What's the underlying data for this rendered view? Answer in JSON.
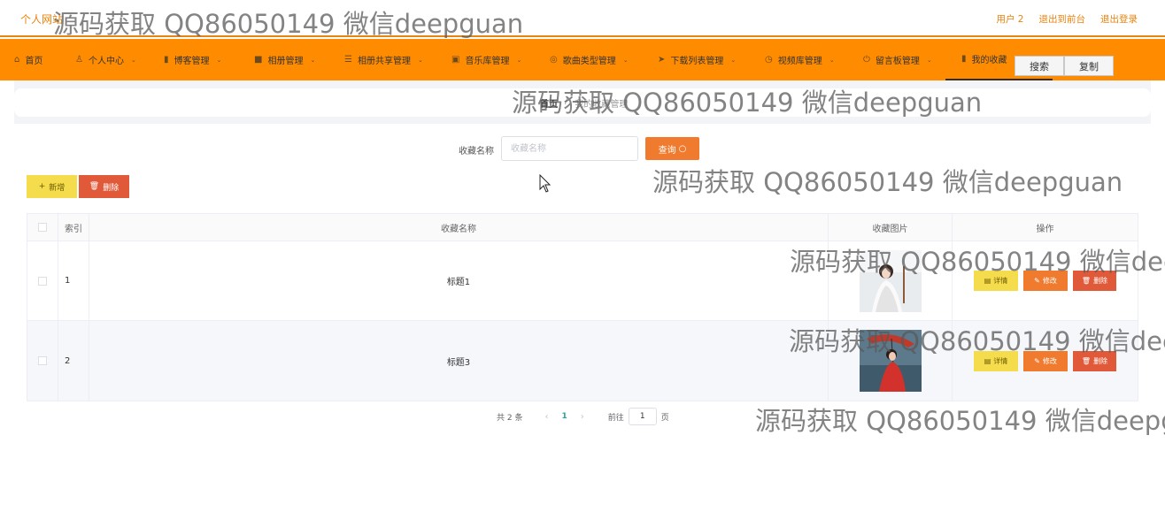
{
  "header": {
    "site_title": "个人网站",
    "links": [
      "用户 2",
      "退出到前台",
      "退出登录"
    ]
  },
  "nav": {
    "items": [
      {
        "label": "首页",
        "icon": "home-icon"
      },
      {
        "label": "个人中心",
        "icon": "user-icon"
      },
      {
        "label": "博客管理",
        "icon": "chart-icon"
      },
      {
        "label": "相册管理",
        "icon": "camera-icon"
      },
      {
        "label": "相册共享管理",
        "icon": "list-icon"
      },
      {
        "label": "音乐库管理",
        "icon": "music-icon"
      },
      {
        "label": "歌曲类型管理",
        "icon": "tag-icon"
      },
      {
        "label": "下载列表管理",
        "icon": "send-icon"
      },
      {
        "label": "视频库管理",
        "icon": "video-icon"
      },
      {
        "label": "留言板管理",
        "icon": "power-icon"
      },
      {
        "label": "我的收藏",
        "icon": "bookmark-icon"
      }
    ],
    "search_button": "搜索",
    "copy_button": "复制"
  },
  "breadcrumb": {
    "home": "首页",
    "current": "我的收藏管理"
  },
  "search": {
    "label": "收藏名称",
    "placeholder": "收藏名称",
    "value": "",
    "query_button": "查询"
  },
  "actions": {
    "add": "新增",
    "delete": "删除"
  },
  "table": {
    "headers": {
      "index": "索引",
      "name": "收藏名称",
      "image": "收藏图片",
      "ops": "操作"
    },
    "rows": [
      {
        "index": "1",
        "name": "标题1",
        "image": "portrait-white-dress"
      },
      {
        "index": "2",
        "name": "标题3",
        "image": "portrait-red-dress"
      }
    ],
    "op_labels": {
      "detail": "详情",
      "edit": "修改",
      "remove": "删除"
    }
  },
  "pagination": {
    "total": "共 2 条",
    "current": "1",
    "goto_prefix": "前往",
    "goto_value": "1",
    "goto_suffix": "页"
  },
  "watermark": "源码获取 QQ86050149 微信deepguan",
  "colors": {
    "accent": "#ff8c00",
    "query": "#f07b2e",
    "danger": "#e05a3a",
    "warning": "#f4dc4d",
    "page_active": "#26a69a"
  }
}
